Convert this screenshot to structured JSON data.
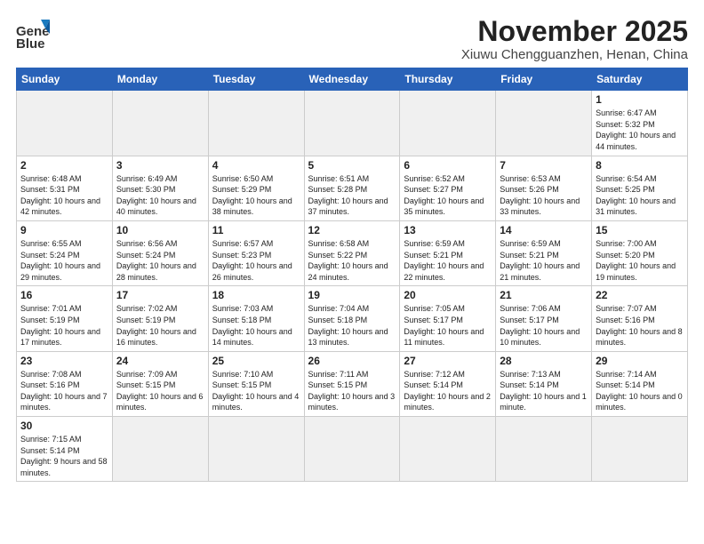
{
  "logo": {
    "line1": "General",
    "line2": "Blue"
  },
  "title": "November 2025",
  "location": "Xiuwu Chengguanzhen, Henan, China",
  "weekdays": [
    "Sunday",
    "Monday",
    "Tuesday",
    "Wednesday",
    "Thursday",
    "Friday",
    "Saturday"
  ],
  "days": [
    {
      "num": "",
      "info": "",
      "empty": true
    },
    {
      "num": "",
      "info": "",
      "empty": true
    },
    {
      "num": "",
      "info": "",
      "empty": true
    },
    {
      "num": "",
      "info": "",
      "empty": true
    },
    {
      "num": "",
      "info": "",
      "empty": true
    },
    {
      "num": "",
      "info": "",
      "empty": true
    },
    {
      "num": "1",
      "info": "Sunrise: 6:47 AM\nSunset: 5:32 PM\nDaylight: 10 hours\nand 44 minutes."
    }
  ],
  "week2": [
    {
      "num": "2",
      "info": "Sunrise: 6:48 AM\nSunset: 5:31 PM\nDaylight: 10 hours\nand 42 minutes."
    },
    {
      "num": "3",
      "info": "Sunrise: 6:49 AM\nSunset: 5:30 PM\nDaylight: 10 hours\nand 40 minutes."
    },
    {
      "num": "4",
      "info": "Sunrise: 6:50 AM\nSunset: 5:29 PM\nDaylight: 10 hours\nand 38 minutes."
    },
    {
      "num": "5",
      "info": "Sunrise: 6:51 AM\nSunset: 5:28 PM\nDaylight: 10 hours\nand 37 minutes."
    },
    {
      "num": "6",
      "info": "Sunrise: 6:52 AM\nSunset: 5:27 PM\nDaylight: 10 hours\nand 35 minutes."
    },
    {
      "num": "7",
      "info": "Sunrise: 6:53 AM\nSunset: 5:26 PM\nDaylight: 10 hours\nand 33 minutes."
    },
    {
      "num": "8",
      "info": "Sunrise: 6:54 AM\nSunset: 5:25 PM\nDaylight: 10 hours\nand 31 minutes."
    }
  ],
  "week3": [
    {
      "num": "9",
      "info": "Sunrise: 6:55 AM\nSunset: 5:24 PM\nDaylight: 10 hours\nand 29 minutes."
    },
    {
      "num": "10",
      "info": "Sunrise: 6:56 AM\nSunset: 5:24 PM\nDaylight: 10 hours\nand 28 minutes."
    },
    {
      "num": "11",
      "info": "Sunrise: 6:57 AM\nSunset: 5:23 PM\nDaylight: 10 hours\nand 26 minutes."
    },
    {
      "num": "12",
      "info": "Sunrise: 6:58 AM\nSunset: 5:22 PM\nDaylight: 10 hours\nand 24 minutes."
    },
    {
      "num": "13",
      "info": "Sunrise: 6:59 AM\nSunset: 5:21 PM\nDaylight: 10 hours\nand 22 minutes."
    },
    {
      "num": "14",
      "info": "Sunrise: 6:59 AM\nSunset: 5:21 PM\nDaylight: 10 hours\nand 21 minutes."
    },
    {
      "num": "15",
      "info": "Sunrise: 7:00 AM\nSunset: 5:20 PM\nDaylight: 10 hours\nand 19 minutes."
    }
  ],
  "week4": [
    {
      "num": "16",
      "info": "Sunrise: 7:01 AM\nSunset: 5:19 PM\nDaylight: 10 hours\nand 17 minutes."
    },
    {
      "num": "17",
      "info": "Sunrise: 7:02 AM\nSunset: 5:19 PM\nDaylight: 10 hours\nand 16 minutes."
    },
    {
      "num": "18",
      "info": "Sunrise: 7:03 AM\nSunset: 5:18 PM\nDaylight: 10 hours\nand 14 minutes."
    },
    {
      "num": "19",
      "info": "Sunrise: 7:04 AM\nSunset: 5:18 PM\nDaylight: 10 hours\nand 13 minutes."
    },
    {
      "num": "20",
      "info": "Sunrise: 7:05 AM\nSunset: 5:17 PM\nDaylight: 10 hours\nand 11 minutes."
    },
    {
      "num": "21",
      "info": "Sunrise: 7:06 AM\nSunset: 5:17 PM\nDaylight: 10 hours\nand 10 minutes."
    },
    {
      "num": "22",
      "info": "Sunrise: 7:07 AM\nSunset: 5:16 PM\nDaylight: 10 hours\nand 8 minutes."
    }
  ],
  "week5": [
    {
      "num": "23",
      "info": "Sunrise: 7:08 AM\nSunset: 5:16 PM\nDaylight: 10 hours\nand 7 minutes."
    },
    {
      "num": "24",
      "info": "Sunrise: 7:09 AM\nSunset: 5:15 PM\nDaylight: 10 hours\nand 6 minutes."
    },
    {
      "num": "25",
      "info": "Sunrise: 7:10 AM\nSunset: 5:15 PM\nDaylight: 10 hours\nand 4 minutes."
    },
    {
      "num": "26",
      "info": "Sunrise: 7:11 AM\nSunset: 5:15 PM\nDaylight: 10 hours\nand 3 minutes."
    },
    {
      "num": "27",
      "info": "Sunrise: 7:12 AM\nSunset: 5:14 PM\nDaylight: 10 hours\nand 2 minutes."
    },
    {
      "num": "28",
      "info": "Sunrise: 7:13 AM\nSunset: 5:14 PM\nDaylight: 10 hours\nand 1 minute."
    },
    {
      "num": "29",
      "info": "Sunrise: 7:14 AM\nSunset: 5:14 PM\nDaylight: 10 hours\nand 0 minutes."
    }
  ],
  "week6": [
    {
      "num": "30",
      "info": "Sunrise: 7:15 AM\nSunset: 5:14 PM\nDaylight: 9 hours\nand 58 minutes."
    },
    {
      "num": "",
      "info": "",
      "empty": true
    },
    {
      "num": "",
      "info": "",
      "empty": true
    },
    {
      "num": "",
      "info": "",
      "empty": true
    },
    {
      "num": "",
      "info": "",
      "empty": true
    },
    {
      "num": "",
      "info": "",
      "empty": true
    },
    {
      "num": "",
      "info": "",
      "empty": true
    }
  ]
}
